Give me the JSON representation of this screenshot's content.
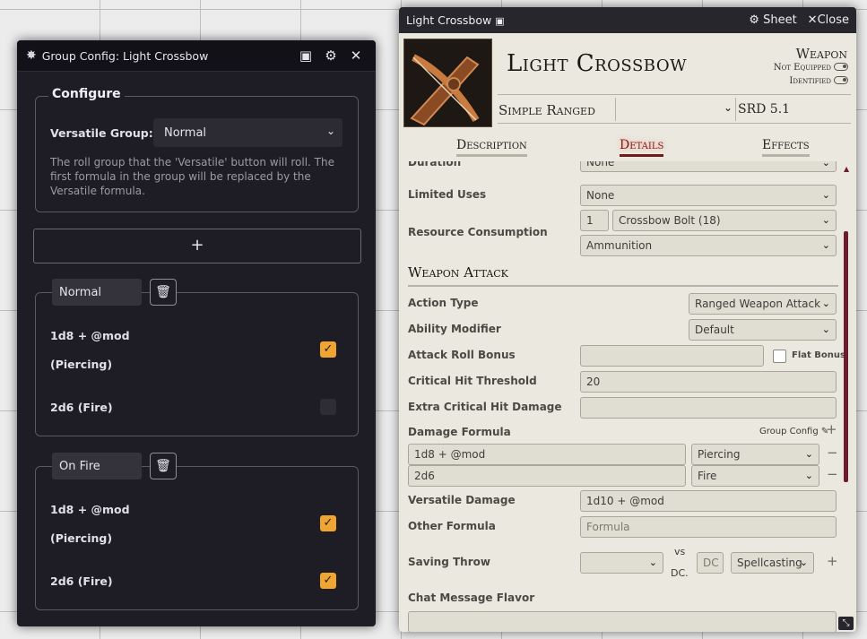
{
  "group_config": {
    "title": "Group Config: Light Crossbow",
    "configure_legend": "Configure",
    "versatile_label": "Versatile Group:",
    "versatile_value": "Normal",
    "hint": "The roll group that the 'Versatile' button will roll. The first formula in the group will be replaced by the Versatile formula.",
    "add_symbol": "+",
    "groups": [
      {
        "name": "Normal",
        "formulas": [
          {
            "line1": "1d8 + @mod",
            "line2": "(Piercing)",
            "checked": true
          },
          {
            "line1": "2d6 (Fire)",
            "line2": "",
            "checked": false
          }
        ]
      },
      {
        "name": "On Fire",
        "formulas": [
          {
            "line1": "1d8 + @mod",
            "line2": "(Piercing)",
            "checked": true
          },
          {
            "line1": "2d6 (Fire)",
            "line2": "",
            "checked": true
          }
        ]
      }
    ]
  },
  "sheet": {
    "window_title": "Light Crossbow",
    "sheet_btn": "Sheet",
    "close_btn": "Close",
    "item_name": "Light Crossbow",
    "item_type": "Weapon",
    "not_equipped": "Not Equipped",
    "identified": "Identified",
    "weapon_type": "Simple Ranged",
    "source": "SRD 5.1",
    "tabs": [
      "Description",
      "Details",
      "Effects"
    ],
    "rows": {
      "duration_label": "Duration",
      "duration_value": "None",
      "limited_label": "Limited Uses",
      "limited_value": "None",
      "resource_label": "Resource Consumption",
      "resource_qty": "1",
      "resource_target": "Crossbow Bolt (18)",
      "resource_type": "Ammunition",
      "section_title": "Weapon Attack",
      "action_label": "Action Type",
      "action_value": "Ranged Weapon Attack",
      "ability_label": "Ability Modifier",
      "ability_value": "Default",
      "attack_label": "Attack Roll Bonus",
      "attack_value": "",
      "flat_bonus": "Flat Bonus",
      "crit_label": "Critical Hit Threshold",
      "crit_value": "20",
      "extra_crit_label": "Extra Critical Hit Damage",
      "extra_crit_value": "",
      "damage_label": "Damage Formula",
      "group_config_link": "Group Config",
      "damage_rows": [
        {
          "formula": "1d8 + @mod",
          "type": "Piercing"
        },
        {
          "formula": "2d6",
          "type": "Fire"
        }
      ],
      "versatile_label": "Versatile Damage",
      "versatile_value": "1d10 + @mod",
      "other_label": "Other Formula",
      "other_placeholder": "Formula",
      "save_label": "Saving Throw",
      "save_ability": "",
      "vs_text": "vs",
      "dc_text": "DC.",
      "dc_placeholder": "DC",
      "save_scaling": "Spellcasting",
      "flavor_label": "Chat Message Flavor",
      "flavor_value": ""
    }
  },
  "colors": {
    "dialog_bg": "#1e1c24",
    "accent_check": "#f0a532",
    "sheet_bg": "#ebe8df",
    "active_tab": "#7a1a1a"
  }
}
